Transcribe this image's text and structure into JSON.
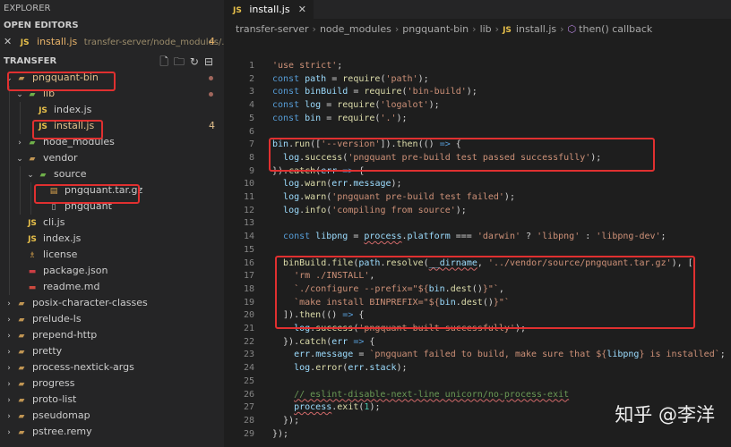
{
  "sidebar": {
    "title": "EXPLORER",
    "open_editors": {
      "label": "OPEN EDITORS",
      "item": {
        "close": "✕",
        "badge": "JS",
        "name": "install.js",
        "path": "transfer-server/node_modules/...",
        "count": "4"
      }
    },
    "section": {
      "label": "TRANSFER"
    },
    "tree": [
      {
        "label": "pngquant-bin",
        "chevron": "⌄",
        "icon": "folder-icon",
        "glyph": "▰",
        "modified": true
      },
      {
        "label": "lib",
        "chevron": "⌄",
        "icon": "folder-icon",
        "glyph": "▰",
        "modified": true
      },
      {
        "label": "index.js",
        "chevron": "",
        "icon": "js-icon",
        "glyph": "JS",
        "modified": false
      },
      {
        "label": "install.js",
        "chevron": "",
        "icon": "js-icon",
        "glyph": "JS",
        "modified": true,
        "badge": "4"
      },
      {
        "label": "node_modules",
        "chevron": "›",
        "icon": "folder-icon",
        "glyph": "▰",
        "modified": false
      },
      {
        "label": "vendor",
        "chevron": "⌄",
        "icon": "folder-icon",
        "glyph": "▰",
        "modified": false
      },
      {
        "label": "source",
        "chevron": "⌄",
        "icon": "folder-icon",
        "glyph": "▰",
        "modified": false
      },
      {
        "label": "pngquant.tar.gz",
        "chevron": "",
        "icon": "archive-icon",
        "glyph": "▤",
        "modified": false
      },
      {
        "label": "pngquant",
        "chevron": "",
        "icon": "file-icon",
        "glyph": "▯",
        "modified": false
      },
      {
        "label": "cli.js",
        "chevron": "",
        "icon": "js-icon",
        "glyph": "JS",
        "modified": false
      },
      {
        "label": "index.js",
        "chevron": "",
        "icon": "js-icon",
        "glyph": "JS",
        "modified": false
      },
      {
        "label": "license",
        "chevron": "",
        "icon": "license-icon",
        "glyph": "♗",
        "modified": false
      },
      {
        "label": "package.json",
        "chevron": "",
        "icon": "package-icon",
        "glyph": "▬",
        "modified": false
      },
      {
        "label": "readme.md",
        "chevron": "",
        "icon": "markdown-icon",
        "glyph": "▬",
        "modified": false
      },
      {
        "label": "posix-character-classes",
        "chevron": "›",
        "icon": "folder-icon",
        "glyph": "▰",
        "modified": false
      },
      {
        "label": "prelude-ls",
        "chevron": "›",
        "icon": "folder-icon",
        "glyph": "▰",
        "modified": false
      },
      {
        "label": "prepend-http",
        "chevron": "›",
        "icon": "folder-icon",
        "glyph": "▰",
        "modified": false
      },
      {
        "label": "pretty",
        "chevron": "›",
        "icon": "folder-icon",
        "glyph": "▰",
        "modified": false
      },
      {
        "label": "process-nextick-args",
        "chevron": "›",
        "icon": "folder-icon",
        "glyph": "▰",
        "modified": false
      },
      {
        "label": "progress",
        "chevron": "›",
        "icon": "folder-icon",
        "glyph": "▰",
        "modified": false
      },
      {
        "label": "proto-list",
        "chevron": "›",
        "icon": "folder-icon",
        "glyph": "▰",
        "modified": false
      },
      {
        "label": "pseudomap",
        "chevron": "›",
        "icon": "folder-icon",
        "glyph": "▰",
        "modified": false
      },
      {
        "label": "pstree.remy",
        "chevron": "›",
        "icon": "folder-icon",
        "glyph": "▰",
        "modified": false
      }
    ]
  },
  "editor": {
    "tab": {
      "badge": "JS",
      "label": "install.js",
      "close": "✕"
    },
    "breadcrumb": [
      "transfer-server",
      "node_modules",
      "pngquant-bin",
      "lib",
      "install.js",
      "then() callback"
    ],
    "breadcrumb_badge": "JS",
    "breadcrumb_symbol": "⬡",
    "lines": [
      {
        "n": "1",
        "tokens": [
          {
            "c": "s",
            "t": "'use strict'"
          },
          {
            "c": "op",
            "t": ";"
          }
        ]
      },
      {
        "n": "2",
        "tokens": [
          {
            "c": "k",
            "t": "const "
          },
          {
            "c": "v",
            "t": "path"
          },
          {
            "c": "op",
            "t": " = "
          },
          {
            "c": "f",
            "t": "require"
          },
          {
            "c": "op",
            "t": "("
          },
          {
            "c": "s",
            "t": "'path'"
          },
          {
            "c": "op",
            "t": ");"
          }
        ]
      },
      {
        "n": "3",
        "tokens": [
          {
            "c": "k",
            "t": "const "
          },
          {
            "c": "v",
            "t": "binBuild"
          },
          {
            "c": "op",
            "t": " = "
          },
          {
            "c": "f",
            "t": "require"
          },
          {
            "c": "op",
            "t": "("
          },
          {
            "c": "s",
            "t": "'bin-build'"
          },
          {
            "c": "op",
            "t": ");"
          }
        ]
      },
      {
        "n": "4",
        "tokens": [
          {
            "c": "k",
            "t": "const "
          },
          {
            "c": "v",
            "t": "log"
          },
          {
            "c": "op",
            "t": " = "
          },
          {
            "c": "f",
            "t": "require"
          },
          {
            "c": "op",
            "t": "("
          },
          {
            "c": "s",
            "t": "'logalot'"
          },
          {
            "c": "op",
            "t": ");"
          }
        ]
      },
      {
        "n": "5",
        "tokens": [
          {
            "c": "k",
            "t": "const "
          },
          {
            "c": "v",
            "t": "bin"
          },
          {
            "c": "op",
            "t": " = "
          },
          {
            "c": "f",
            "t": "require"
          },
          {
            "c": "op",
            "t": "("
          },
          {
            "c": "s",
            "t": "'.'"
          },
          {
            "c": "op",
            "t": ");"
          }
        ]
      },
      {
        "n": "6",
        "tokens": []
      },
      {
        "n": "7",
        "tokens": [
          {
            "c": "v",
            "t": "bin"
          },
          {
            "c": "op",
            "t": "."
          },
          {
            "c": "f",
            "t": "run"
          },
          {
            "c": "op",
            "t": "(["
          },
          {
            "c": "s",
            "t": "'--version'"
          },
          {
            "c": "op",
            "t": "])."
          },
          {
            "c": "f",
            "t": "then"
          },
          {
            "c": "op",
            "t": "(() "
          },
          {
            "c": "k",
            "t": "=>"
          },
          {
            "c": "op",
            "t": " {"
          }
        ]
      },
      {
        "n": "8",
        "tokens": [
          {
            "c": "op",
            "t": "  "
          },
          {
            "c": "v",
            "t": "log"
          },
          {
            "c": "op",
            "t": "."
          },
          {
            "c": "f",
            "t": "success"
          },
          {
            "c": "op",
            "t": "("
          },
          {
            "c": "s",
            "t": "'pngquant pre-build test passed successfully'"
          },
          {
            "c": "op",
            "t": ");"
          }
        ]
      },
      {
        "n": "9",
        "tokens": [
          {
            "c": "op",
            "t": "})."
          },
          {
            "c": "f",
            "t": "catch"
          },
          {
            "c": "op",
            "t": "("
          },
          {
            "c": "v",
            "t": "err"
          },
          {
            "c": "op",
            "t": " "
          },
          {
            "c": "k",
            "t": "=>"
          },
          {
            "c": "op",
            "t": " {"
          }
        ]
      },
      {
        "n": "10",
        "tokens": [
          {
            "c": "op",
            "t": "  "
          },
          {
            "c": "v",
            "t": "log"
          },
          {
            "c": "op",
            "t": "."
          },
          {
            "c": "f",
            "t": "warn"
          },
          {
            "c": "op",
            "t": "("
          },
          {
            "c": "v",
            "t": "err"
          },
          {
            "c": "op",
            "t": "."
          },
          {
            "c": "v",
            "t": "message"
          },
          {
            "c": "op",
            "t": ");"
          }
        ]
      },
      {
        "n": "11",
        "tokens": [
          {
            "c": "op",
            "t": "  "
          },
          {
            "c": "v",
            "t": "log"
          },
          {
            "c": "op",
            "t": "."
          },
          {
            "c": "f",
            "t": "warn"
          },
          {
            "c": "op",
            "t": "("
          },
          {
            "c": "s",
            "t": "'pngquant pre-build test failed'"
          },
          {
            "c": "op",
            "t": ");"
          }
        ]
      },
      {
        "n": "12",
        "tokens": [
          {
            "c": "op",
            "t": "  "
          },
          {
            "c": "v",
            "t": "log"
          },
          {
            "c": "op",
            "t": "."
          },
          {
            "c": "f",
            "t": "info"
          },
          {
            "c": "op",
            "t": "("
          },
          {
            "c": "s",
            "t": "'compiling from source'"
          },
          {
            "c": "op",
            "t": ");"
          }
        ]
      },
      {
        "n": "13",
        "tokens": []
      },
      {
        "n": "14",
        "tokens": [
          {
            "c": "op",
            "t": "  "
          },
          {
            "c": "k",
            "t": "const "
          },
          {
            "c": "v",
            "t": "libpng"
          },
          {
            "c": "op",
            "t": " = "
          },
          {
            "c": "v",
            "t": "process"
          },
          {
            "c": "op",
            "t": "."
          },
          {
            "c": "v",
            "t": "platform"
          },
          {
            "c": "op",
            "t": " === "
          },
          {
            "c": "s",
            "t": "'darwin'"
          },
          {
            "c": "op",
            "t": " ? "
          },
          {
            "c": "s",
            "t": "'libpng'"
          },
          {
            "c": "op",
            "t": " : "
          },
          {
            "c": "s",
            "t": "'libpng-dev'"
          },
          {
            "c": "op",
            "t": ";"
          }
        ]
      },
      {
        "n": "15",
        "tokens": []
      },
      {
        "n": "16",
        "tokens": [
          {
            "c": "op",
            "t": "  "
          },
          {
            "c": "f",
            "t": "binBuild"
          },
          {
            "c": "op",
            "t": "."
          },
          {
            "c": "f",
            "t": "file"
          },
          {
            "c": "op",
            "t": "("
          },
          {
            "c": "v",
            "t": "path"
          },
          {
            "c": "op",
            "t": "."
          },
          {
            "c": "f",
            "t": "resolve"
          },
          {
            "c": "op",
            "t": "("
          },
          {
            "c": "v",
            "t": "__dirname"
          },
          {
            "c": "op",
            "t": ", "
          },
          {
            "c": "s",
            "t": "'../vendor/source/pngquant.tar.gz'"
          },
          {
            "c": "op",
            "t": "), ["
          }
        ]
      },
      {
        "n": "17",
        "tokens": [
          {
            "c": "op",
            "t": "    "
          },
          {
            "c": "s",
            "t": "'rm ./INSTALL'"
          },
          {
            "c": "op",
            "t": ","
          }
        ]
      },
      {
        "n": "18",
        "tokens": [
          {
            "c": "op",
            "t": "    "
          },
          {
            "c": "s",
            "t": "`./configure --prefix=\"${"
          },
          {
            "c": "v",
            "t": "bin"
          },
          {
            "c": "op",
            "t": "."
          },
          {
            "c": "f",
            "t": "dest"
          },
          {
            "c": "op",
            "t": "()"
          },
          {
            "c": "s",
            "t": "}\"`"
          },
          {
            "c": "op",
            "t": ","
          }
        ]
      },
      {
        "n": "19",
        "tokens": [
          {
            "c": "op",
            "t": "    "
          },
          {
            "c": "s",
            "t": "`make install BINPREFIX=\"${"
          },
          {
            "c": "v",
            "t": "bin"
          },
          {
            "c": "op",
            "t": "."
          },
          {
            "c": "f",
            "t": "dest"
          },
          {
            "c": "op",
            "t": "()"
          },
          {
            "c": "s",
            "t": "}\"`"
          }
        ]
      },
      {
        "n": "20",
        "tokens": [
          {
            "c": "op",
            "t": "  ])."
          },
          {
            "c": "f",
            "t": "then"
          },
          {
            "c": "op",
            "t": "(() "
          },
          {
            "c": "k",
            "t": "=>"
          },
          {
            "c": "op",
            "t": " {"
          }
        ]
      },
      {
        "n": "21",
        "tokens": [
          {
            "c": "op",
            "t": "    "
          },
          {
            "c": "v",
            "t": "log"
          },
          {
            "c": "op",
            "t": "."
          },
          {
            "c": "f",
            "t": "success"
          },
          {
            "c": "op",
            "t": "("
          },
          {
            "c": "s",
            "t": "'pngquant built successfully'"
          },
          {
            "c": "op",
            "t": ");"
          }
        ]
      },
      {
        "n": "22",
        "tokens": [
          {
            "c": "op",
            "t": "  })."
          },
          {
            "c": "f",
            "t": "catch"
          },
          {
            "c": "op",
            "t": "("
          },
          {
            "c": "v",
            "t": "err"
          },
          {
            "c": "op",
            "t": " "
          },
          {
            "c": "k",
            "t": "=>"
          },
          {
            "c": "op",
            "t": " {"
          }
        ]
      },
      {
        "n": "23",
        "tokens": [
          {
            "c": "op",
            "t": "    "
          },
          {
            "c": "v",
            "t": "err"
          },
          {
            "c": "op",
            "t": "."
          },
          {
            "c": "v",
            "t": "message"
          },
          {
            "c": "op",
            "t": " = "
          },
          {
            "c": "s",
            "t": "`pngquant failed to build, make sure that ${"
          },
          {
            "c": "v",
            "t": "libpng"
          },
          {
            "c": "s",
            "t": "} is installed`"
          },
          {
            "c": "op",
            "t": ";"
          }
        ]
      },
      {
        "n": "24",
        "tokens": [
          {
            "c": "op",
            "t": "    "
          },
          {
            "c": "v",
            "t": "log"
          },
          {
            "c": "op",
            "t": "."
          },
          {
            "c": "f",
            "t": "error"
          },
          {
            "c": "op",
            "t": "("
          },
          {
            "c": "v",
            "t": "err"
          },
          {
            "c": "op",
            "t": "."
          },
          {
            "c": "v",
            "t": "stack"
          },
          {
            "c": "op",
            "t": ");"
          }
        ]
      },
      {
        "n": "25",
        "tokens": []
      },
      {
        "n": "26",
        "tokens": [
          {
            "c": "op",
            "t": "    "
          },
          {
            "c": "c",
            "t": "// eslint-disable-next-line unicorn/no-process-exit"
          }
        ]
      },
      {
        "n": "27",
        "tokens": [
          {
            "c": "op",
            "t": "    "
          },
          {
            "c": "v",
            "t": "process"
          },
          {
            "c": "op",
            "t": "."
          },
          {
            "c": "f",
            "t": "exit"
          },
          {
            "c": "op",
            "t": "("
          },
          {
            "c": "t",
            "t": "1"
          },
          {
            "c": "op",
            "t": ");"
          }
        ]
      },
      {
        "n": "28",
        "tokens": [
          {
            "c": "op",
            "t": "  });"
          }
        ]
      },
      {
        "n": "29",
        "tokens": [
          {
            "c": "op",
            "t": "});"
          }
        ]
      }
    ]
  },
  "watermark": {
    "text": "知乎 @李洋"
  },
  "colors": {
    "highlight": "#e03030",
    "background": "#1e1e1e",
    "sidebar": "#252526"
  }
}
